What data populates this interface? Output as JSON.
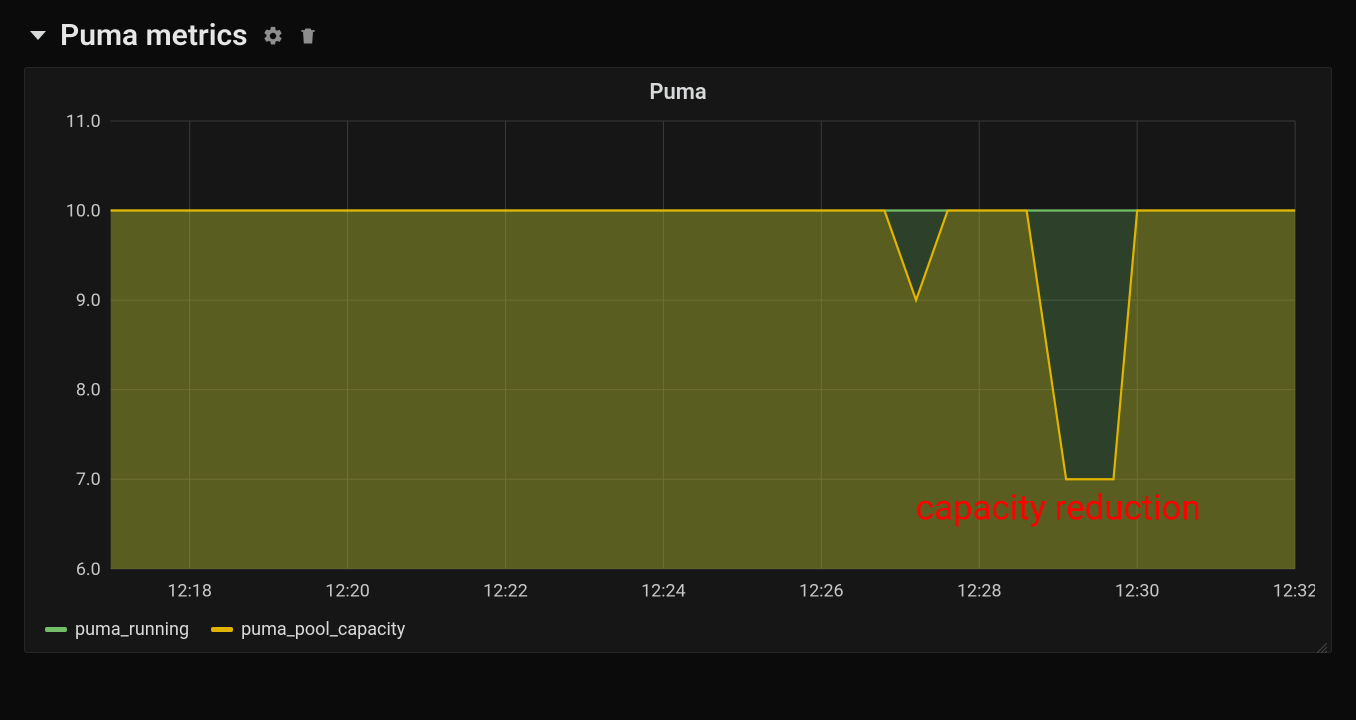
{
  "header": {
    "title": "Puma metrics",
    "settings_icon": "settings",
    "delete_icon": "trash"
  },
  "chart_data": {
    "type": "area",
    "title": "Puma",
    "xlabel": "",
    "ylabel": "",
    "ylim": [
      6.0,
      11.0
    ],
    "y_ticks": [
      "6.0",
      "7.0",
      "8.0",
      "9.0",
      "10.0",
      "11.0"
    ],
    "x_ticks": [
      "12:18",
      "12:20",
      "12:22",
      "12:24",
      "12:26",
      "12:28",
      "12:30",
      "12:32"
    ],
    "x_range_minutes": [
      17,
      32
    ],
    "series": [
      {
        "name": "puma_running",
        "color": "#73bf69",
        "points": [
          {
            "x": 17,
            "y": 10.0
          },
          {
            "x": 32,
            "y": 10.0
          }
        ]
      },
      {
        "name": "puma_pool_capacity",
        "color": "#e0b400",
        "points": [
          {
            "x": 17.0,
            "y": 10.0
          },
          {
            "x": 26.8,
            "y": 10.0
          },
          {
            "x": 27.2,
            "y": 9.0
          },
          {
            "x": 27.6,
            "y": 10.0
          },
          {
            "x": 28.6,
            "y": 10.0
          },
          {
            "x": 29.1,
            "y": 7.0
          },
          {
            "x": 29.7,
            "y": 7.0
          },
          {
            "x": 30.0,
            "y": 10.0
          },
          {
            "x": 32.0,
            "y": 10.0
          }
        ]
      }
    ],
    "annotation": {
      "text": "capacity reduction",
      "x_minute": 29,
      "y_value": 6.55,
      "color": "#ff0000"
    }
  },
  "legend": {
    "items": [
      {
        "label": "puma_running",
        "color": "#73bf69"
      },
      {
        "label": "puma_pool_capacity",
        "color": "#e0b400"
      }
    ]
  }
}
